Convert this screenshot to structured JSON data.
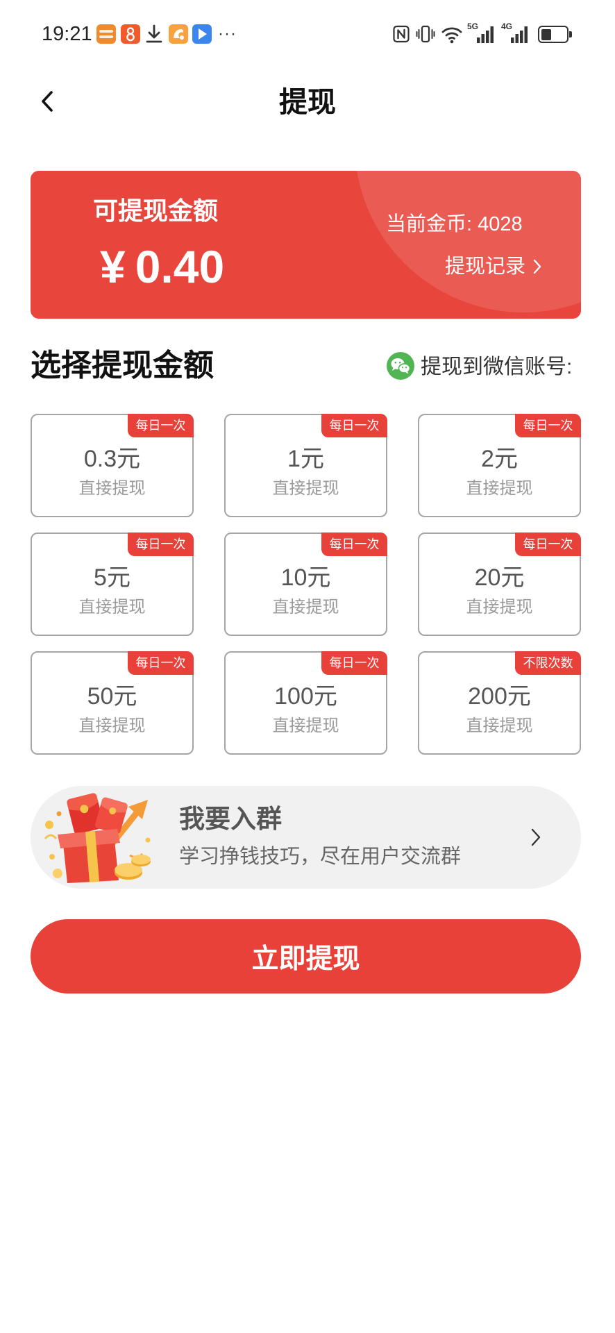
{
  "status_bar": {
    "time": "19:21",
    "more": "···",
    "signal_1_label": "5G",
    "signal_2_label": "4G",
    "battery_level": 0.4
  },
  "header": {
    "title": "提现"
  },
  "balance_card": {
    "label": "可提现金额",
    "currency": "¥",
    "amount": "0.40",
    "coins_label": "当前金币: 4028",
    "record_label": "提现记录"
  },
  "section": {
    "title": "选择提现金额",
    "wechat_label": "提现到微信账号:"
  },
  "amount_options": [
    {
      "amount": "0.3",
      "unit": "元",
      "sub": "直接提现",
      "badge": "每日一次"
    },
    {
      "amount": "1",
      "unit": "元",
      "sub": "直接提现",
      "badge": "每日一次"
    },
    {
      "amount": "2",
      "unit": "元",
      "sub": "直接提现",
      "badge": "每日一次"
    },
    {
      "amount": "5",
      "unit": "元",
      "sub": "直接提现",
      "badge": "每日一次"
    },
    {
      "amount": "10",
      "unit": "元",
      "sub": "直接提现",
      "badge": "每日一次"
    },
    {
      "amount": "20",
      "unit": "元",
      "sub": "直接提现",
      "badge": "每日一次"
    },
    {
      "amount": "50",
      "unit": "元",
      "sub": "直接提现",
      "badge": "每日一次"
    },
    {
      "amount": "100",
      "unit": "元",
      "sub": "直接提现",
      "badge": "每日一次"
    },
    {
      "amount": "200",
      "unit": "元",
      "sub": "直接提现",
      "badge": "不限次数"
    }
  ],
  "group_banner": {
    "title": "我要入群",
    "subtitle": "学习挣钱技巧，尽在用户交流群"
  },
  "submit_button": {
    "label": "立即提现"
  },
  "icons": {
    "back": "chevron-left-icon",
    "record": "chevron-right-icon",
    "wechat": "wechat-icon",
    "banner": "gift-icon",
    "banner_arrow": "chevron-right-icon",
    "status": [
      "app-icon",
      "download-icon",
      "nfc-icon",
      "vibrate-icon",
      "wifi-icon",
      "signal-icon",
      "battery-icon"
    ]
  },
  "colors": {
    "accent": "#e8413a",
    "card": "#e8453c",
    "wechat": "#52b554",
    "banner_bg": "#f1f1f1"
  }
}
